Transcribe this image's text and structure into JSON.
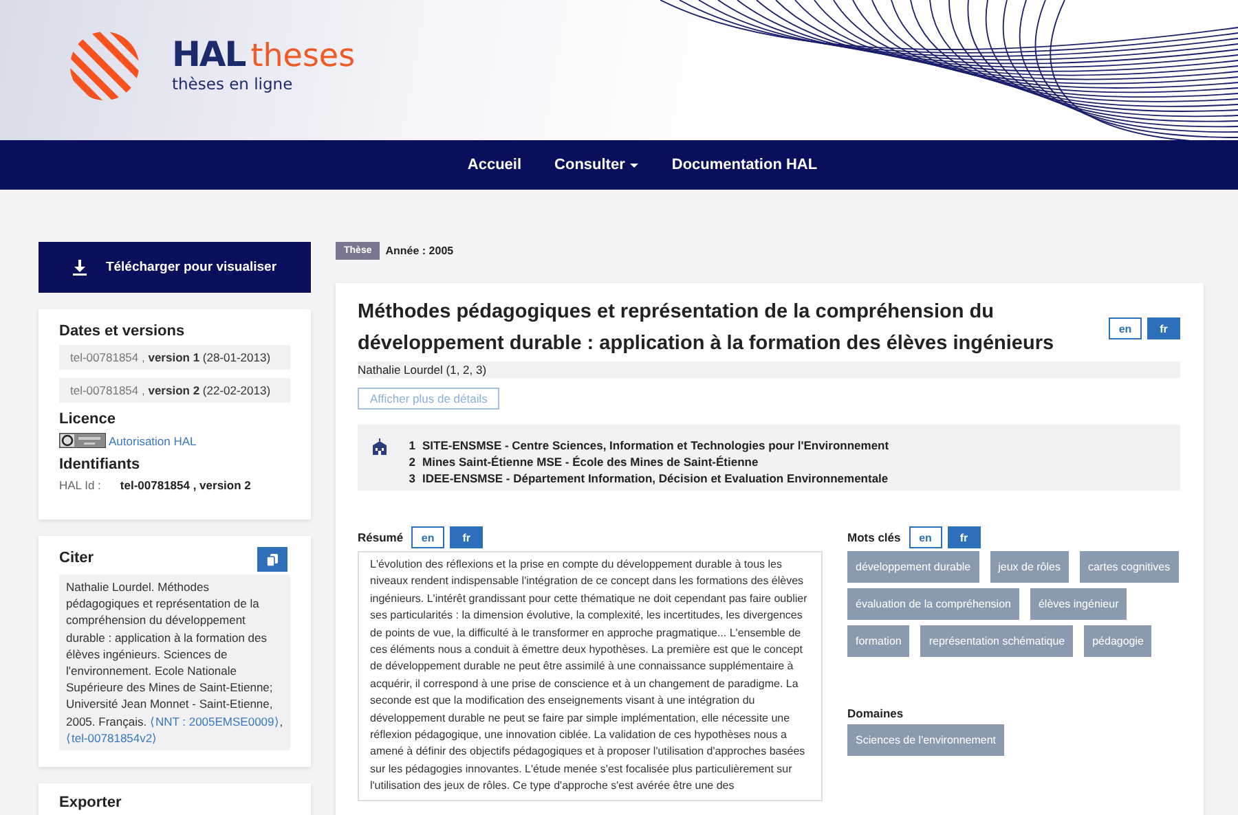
{
  "header": {
    "brand_main": "HAL",
    "brand_sub": "theses",
    "tagline": "thèses en ligne"
  },
  "nav": [
    {
      "label": "Accueil",
      "dropdown": false
    },
    {
      "label": "Consulter",
      "dropdown": true
    },
    {
      "label": "Documentation HAL",
      "dropdown": false
    }
  ],
  "sidebar": {
    "download": "Télécharger pour visualiser",
    "dates_title": "Dates et versions",
    "versions": [
      {
        "id": "tel-00781854 ,",
        "version": "version 1",
        "date": "(28-01-2013)"
      },
      {
        "id": "tel-00781854 ,",
        "version": "version 2",
        "date": "(22-02-2013)"
      }
    ],
    "licence_title": "Licence",
    "licence_link": "Autorisation HAL",
    "ids_title": "Identifiants",
    "hal_id_label": "HAL Id :",
    "hal_id_value": "tel-00781854 , version 2",
    "cite_title": "Citer",
    "citation": "Nathalie Lourdel. Méthodes pédagogiques et représentation de la compréhension du développement durable : application à la formation des élèves ingénieurs. Sciences de l'environnement. Ecole Nationale Supérieure des Mines de Saint-Etienne; Université Jean Monnet - Saint-Etienne, 2005. Français.",
    "citation_links": [
      "⟨NNT : 2005EMSE0009⟩",
      "⟨tel-00781854v2⟩"
    ],
    "citation_link_separator": ",",
    "export_title": "Exporter"
  },
  "doc": {
    "type": "Thèse",
    "year": "Année : 2005",
    "title": "Méthodes pédagogiques et représentation de la compréhension du développement durable : application à la formation des élèves ingénieurs",
    "title_langs": [
      {
        "label": "en",
        "selected": false
      },
      {
        "label": "fr",
        "selected": true
      }
    ],
    "author": "Nathalie Lourdel (1, 2, 3)",
    "details_button": "Afficher plus de détails",
    "affiliations": [
      {
        "num": "1",
        "name": "SITE-ENSMSE - Centre Sciences, Information et Technologies pour l'Environnement"
      },
      {
        "num": "2",
        "name": "Mines Saint-Étienne MSE - École des Mines de Saint-Étienne"
      },
      {
        "num": "3",
        "name": "IDEE-ENSMSE - Département Information, Décision et Evaluation Environnementale"
      }
    ],
    "abstract_title": "Résumé",
    "abstract_langs": [
      {
        "label": "en",
        "selected": false
      },
      {
        "label": "fr",
        "selected": true
      }
    ],
    "abstract": "L'évolution des réflexions et la prise en compte du développement durable à tous les niveaux rendent indispensable l'intégration de ce concept dans les formations des élèves ingénieurs. L'intérêt grandissant pour cette thématique ne doit cependant pas faire oublier ses particularités : la dimension évolutive, la complexité, les incertitudes, les divergences de points de vue, la difficulté à le transformer en approche pragmatique... L'ensemble de ces éléments nous a conduit à émettre deux hypothèses. La première est que le concept de développement durable ne peut être assimilé à une connaissance supplémentaire à acquérir, il correspond à une prise de conscience et à un changement de paradigme. La seconde est que la modification des enseignements visant à une intégration du développement durable ne peut se faire par simple implémentation, elle nécessite une réflexion pédagogique, une innovation ciblée. La validation de ces hypothèses nous a amené à définir des objectifs pédagogiques et à proposer l'utilisation d'approches basées sur les pédagogies innovantes. L'étude menée s'est focalisée plus particulièrement sur l'utilisation des jeux de rôles. Ce type d'approche s'est avérée être une des",
    "keywords_title": "Mots clés",
    "keyword_langs": [
      {
        "label": "en",
        "selected": false
      },
      {
        "label": "fr",
        "selected": true
      }
    ],
    "keywords": [
      "développement durable",
      "jeux de rôles",
      "cartes cognitives",
      "évaluation de la compréhension",
      "élèves ingénieur",
      "formation",
      "représentation schématique",
      "pédagogie"
    ],
    "domains_title": "Domaines",
    "domains": [
      "Sciences de l'environnement"
    ]
  }
}
